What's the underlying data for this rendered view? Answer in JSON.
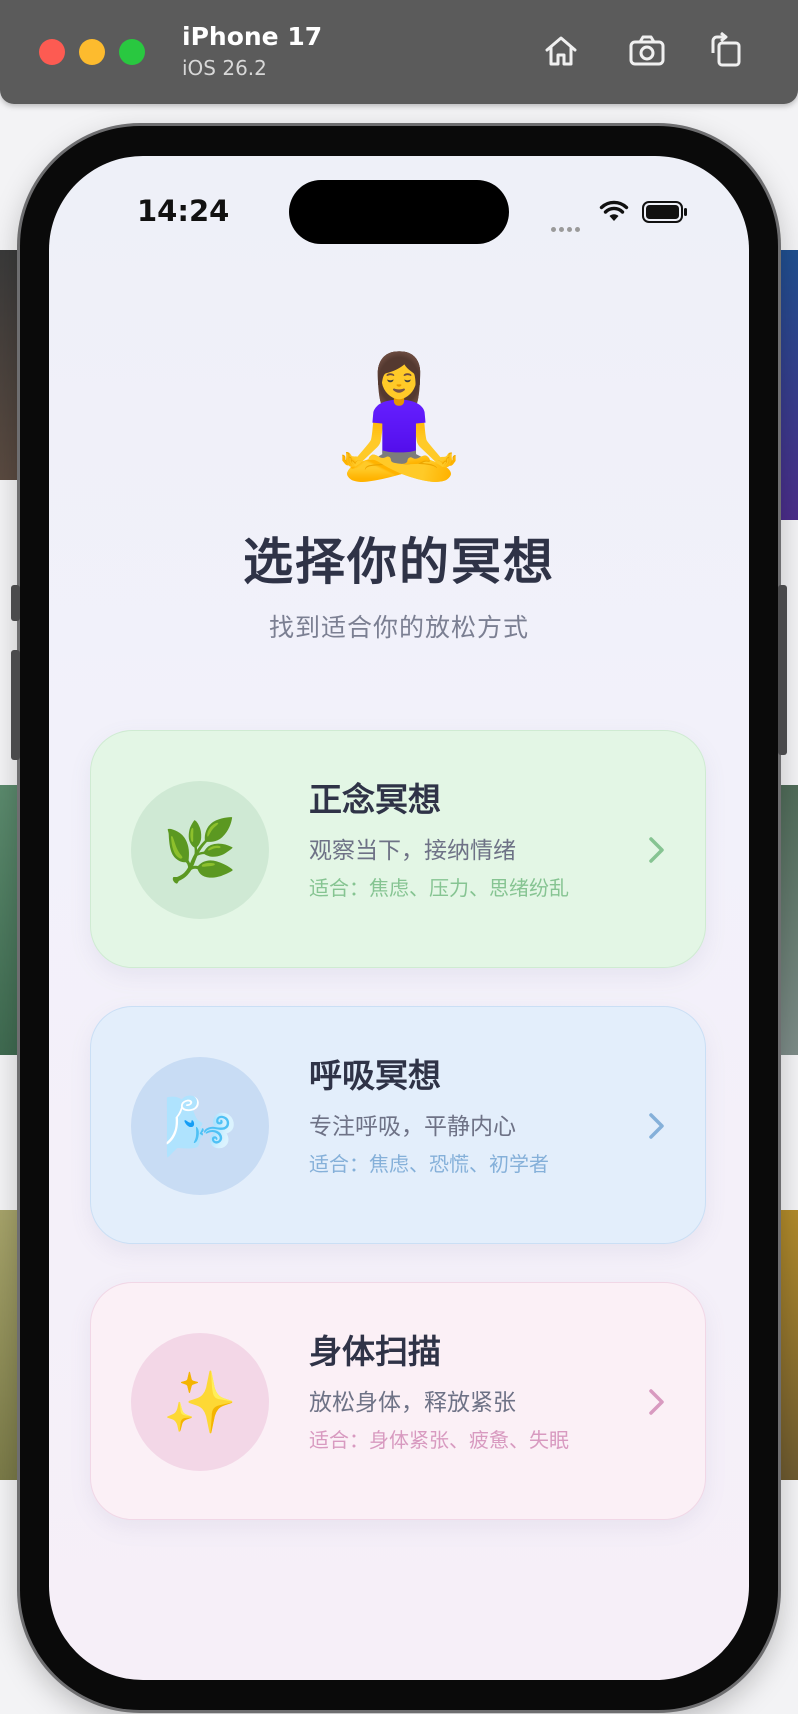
{
  "simulator": {
    "device_name": "iPhone 17",
    "os_version": "iOS 26.2",
    "home_icon": "home-icon",
    "screenshot_icon": "camera-icon",
    "rotate_icon": "rotate-icon"
  },
  "status_bar": {
    "time": "14:24",
    "wifi_icon": "wifi-icon",
    "battery_icon": "battery-icon"
  },
  "header": {
    "emoji": "🧘‍♀️",
    "title": "选择你的冥想",
    "subtitle": "找到适合你的放松方式"
  },
  "meditations": [
    {
      "emoji": "🌿",
      "title": "正念冥想",
      "description": "观察当下，接纳情绪",
      "fit": "适合：焦虑、压力、思绪纷乱",
      "accent": "#86c492"
    },
    {
      "emoji": "🌬️",
      "title": "呼吸冥想",
      "description": "专注呼吸，平静内心",
      "fit": "适合：焦虑、恐慌、初学者",
      "accent": "#85b0d9"
    },
    {
      "emoji": "✨",
      "title": "身体扫描",
      "description": "放松身体，释放紧张",
      "fit": "适合：身体紧张、疲惫、失眠",
      "accent": "#d89ac0"
    }
  ]
}
